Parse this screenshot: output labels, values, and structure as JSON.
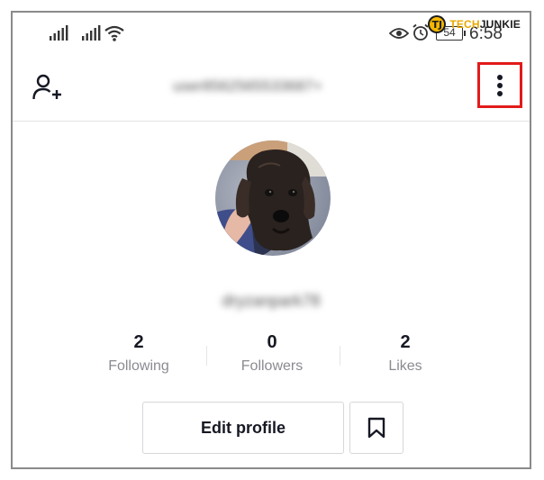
{
  "watermark": {
    "badge": "TJ",
    "brand_part1": "TECH",
    "brand_part2": "JUNKIE"
  },
  "status_bar": {
    "battery": "54",
    "time": "6:58"
  },
  "header": {
    "username": "user8562565533687+"
  },
  "profile": {
    "handle": "dryzanpark78"
  },
  "stats": [
    {
      "value": "2",
      "label": "Following"
    },
    {
      "value": "0",
      "label": "Followers"
    },
    {
      "value": "2",
      "label": "Likes"
    }
  ],
  "actions": {
    "edit_profile": "Edit profile"
  },
  "colors": {
    "highlight": "#e21b1b",
    "text": "#161823",
    "muted": "#8a8b91"
  }
}
